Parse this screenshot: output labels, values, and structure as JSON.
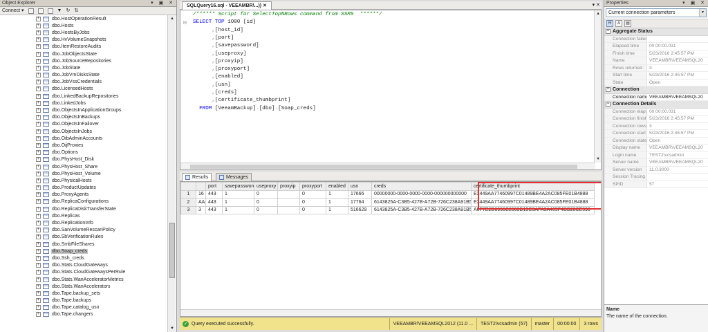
{
  "object_explorer": {
    "title": "Object Explorer",
    "connect_label": "Connect",
    "items": [
      "dbo.HostOperationResult",
      "dbo.Hosts",
      "dbo.HostsByJobs",
      "dbo.HvVolumeSnapshots",
      "dbo.ItemRestoreAudits",
      "dbo.JobObjectsState",
      "dbo.JobSourceRepositories",
      "dbo.JobState",
      "dbo.JobVmDisksState",
      "dbo.JobVssCredentials",
      "dbo.LicensedHosts",
      "dbo.LinkedBackupRepositories",
      "dbo.LinkedJobs",
      "dbo.ObjectsInApplicationGroups",
      "dbo.ObjectsInBackups",
      "dbo.ObjectsInFailover",
      "dbo.ObjectsInJobs",
      "dbo.OibAdminAccounts",
      "dbo.OijProxies",
      "dbo.Options",
      "dbo.PhysHost_Disk",
      "dbo.PhysHost_Share",
      "dbo.PhysHost_Volume",
      "dbo.PhysicalHosts",
      "dbo.ProductUpdates",
      "dbo.ProxyAgents",
      "dbo.ReplicaConfigurations",
      "dbo.ReplicaDiskTransferState",
      "dbo.Replicas",
      "dbo.ReplicationInfo",
      "dbo.SanVolumeRescanPolicy",
      "dbo.SbVerificationRules",
      "dbo.SmbFileShares",
      "dbo.Soap_creds",
      "dbo.Ssh_creds",
      "dbo.Stats.CloudGateways",
      "dbo.Stats.CloudGatewaysPerRule",
      "dbo.Stats.WanAcceleratorMetrics",
      "dbo.Stats.WanAccelerators",
      "dbo.Tape.backup_sets",
      "dbo.Tape.backups",
      "dbo.Tape.catalog_usn",
      "dbo.Tape.changers"
    ],
    "selected_index": 33
  },
  "editor": {
    "tab_title": "SQLQuery16.sql - VEEAMBR\\...))",
    "lines": [
      {
        "parts": [
          {
            "t": "cm",
            "v": "/****** Script for SelectTopNRows command from SSMS  ******/"
          }
        ]
      },
      {
        "parts": [
          {
            "t": "kw",
            "v": "SELECT TOP "
          },
          {
            "t": "id",
            "v": "1000 [id]"
          }
        ]
      },
      {
        "parts": [
          {
            "t": "gr",
            "v": "      ,"
          },
          {
            "t": "id",
            "v": "[host_id]"
          }
        ]
      },
      {
        "parts": [
          {
            "t": "gr",
            "v": "      ,"
          },
          {
            "t": "id",
            "v": "[port]"
          }
        ]
      },
      {
        "parts": [
          {
            "t": "gr",
            "v": "      ,"
          },
          {
            "t": "id",
            "v": "[savepassword]"
          }
        ]
      },
      {
        "parts": [
          {
            "t": "gr",
            "v": "      ,"
          },
          {
            "t": "id",
            "v": "[useproxy]"
          }
        ]
      },
      {
        "parts": [
          {
            "t": "gr",
            "v": "      ,"
          },
          {
            "t": "id",
            "v": "[proxyip]"
          }
        ]
      },
      {
        "parts": [
          {
            "t": "gr",
            "v": "      ,"
          },
          {
            "t": "id",
            "v": "[proxyport]"
          }
        ]
      },
      {
        "parts": [
          {
            "t": "gr",
            "v": "      ,"
          },
          {
            "t": "id",
            "v": "[enabled]"
          }
        ]
      },
      {
        "parts": [
          {
            "t": "gr",
            "v": "      ,"
          },
          {
            "t": "id",
            "v": "[usn]"
          }
        ]
      },
      {
        "parts": [
          {
            "t": "gr",
            "v": "      ,"
          },
          {
            "t": "id",
            "v": "[creds]"
          }
        ]
      },
      {
        "parts": [
          {
            "t": "gr",
            "v": "      ,"
          },
          {
            "t": "id",
            "v": "[certificate_thumbprint]"
          }
        ]
      },
      {
        "parts": [
          {
            "t": "kw",
            "v": "  FROM "
          },
          {
            "t": "id",
            "v": "[VeeamBackup]"
          },
          {
            "t": "gr",
            "v": "."
          },
          {
            "t": "id",
            "v": "[dbo]"
          },
          {
            "t": "gr",
            "v": "."
          },
          {
            "t": "id",
            "v": "[Soap_creds]"
          }
        ]
      }
    ]
  },
  "results": {
    "tab_results": "Results",
    "tab_messages": "Messages",
    "columns": [
      "",
      "",
      "port",
      "savepassword",
      "useproxy",
      "proxyip",
      "proxyport",
      "enabled",
      "usn",
      "creds",
      "certificate_thumbprint"
    ],
    "rows": [
      [
        "1",
        "16",
        "443",
        "1",
        "0",
        "",
        "0",
        "1",
        "17666",
        "00000000-0000-0000-0000-000000000000",
        "E3449AA77460997C01489BE4A2AC085FE01B4888"
      ],
      [
        "2",
        "AA",
        "443",
        "1",
        "0",
        "",
        "0",
        "1",
        "17764",
        "6143825A-C3B5-427B-A72B-726C238A91B5",
        "E3449AA77460997C01489BE4A2AC085FE01B4888"
      ],
      [
        "3",
        "3",
        "443",
        "1",
        "0",
        "",
        "0",
        "1",
        "516629",
        "6143825A-C3B5-427B-A72B-726C238A91B5",
        "A6F7E2D6956C2663D15C3AFA3A405F4DB28CE590"
      ]
    ]
  },
  "status": {
    "message": "Query executed successfully.",
    "server": "VEEAMBR\\VEEAMSQL2012 (11.0 ...",
    "user": "TEST2\\vcsadmin (57)",
    "database": "master",
    "time": "00:00:00",
    "rows": "3 rows"
  },
  "properties": {
    "title": "Properties",
    "selector": "Current connection parameters",
    "categories": [
      {
        "name": "Aggregate Status",
        "rows": [
          [
            "Connection failures",
            "",
            false
          ],
          [
            "Elapsed time",
            "00:00:00.031",
            false
          ],
          [
            "Finish time",
            "5/23/2016 2:45:57 PM",
            false
          ],
          [
            "Name",
            "VEEAMBR\\VEEAMSQL20",
            false
          ],
          [
            "Rows returned",
            "3",
            false
          ],
          [
            "Start time",
            "5/23/2016 2:45:57 PM",
            false
          ],
          [
            "State",
            "Open",
            false
          ]
        ]
      },
      {
        "name": "Connection",
        "rows": [
          [
            "Connection name",
            "VEEAMBR\\VEEAMSQL20",
            true
          ]
        ]
      },
      {
        "name": "Connection Details",
        "rows": [
          [
            "Connection elapsed",
            "00:00:00.031",
            false
          ],
          [
            "Connection finish ti",
            "5/23/2016 2:45:57 PM",
            false
          ],
          [
            "Connection rows re",
            "3",
            false
          ],
          [
            "Connection start tin",
            "5/23/2016 2:45:57 PM",
            false
          ],
          [
            "Connection state",
            "Open",
            false
          ],
          [
            "Display name",
            "VEEAMBR\\VEEAMSQL20",
            false
          ],
          [
            "Login name",
            "TEST2\\vcsadmin",
            false
          ],
          [
            "Server name",
            "VEEAMBR\\VEEAMSQL20",
            false
          ],
          [
            "Server version",
            "11.0.3000",
            false
          ],
          [
            "Session Tracing ID",
            "",
            false
          ],
          [
            "SPID",
            "57",
            false
          ]
        ]
      }
    ],
    "description_title": "Name",
    "description_text": "The name of the connection."
  }
}
